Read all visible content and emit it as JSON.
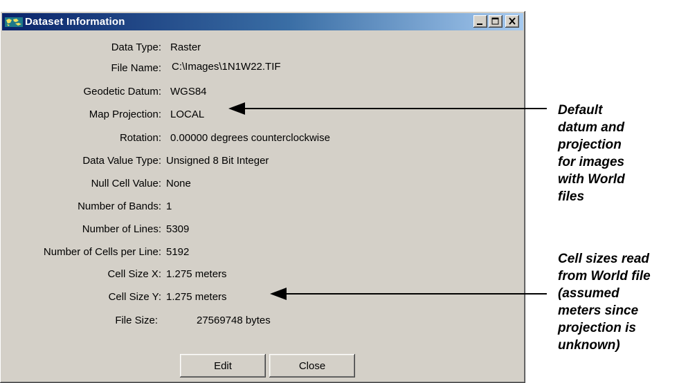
{
  "window": {
    "title": "Dataset Information",
    "controls": {
      "minimize": "minimize",
      "maximize": "maximize",
      "close": "close"
    }
  },
  "fields": [
    {
      "label": "Data Type:",
      "value": "Raster"
    },
    {
      "label": "File Name:",
      "value": "C:\\Images\\1N1W22.TIF"
    },
    {
      "label": "Geodetic Datum:",
      "value": "WGS84"
    },
    {
      "label": "Map Projection:",
      "value": "LOCAL"
    },
    {
      "label": "Rotation:",
      "value": "0.00000 degrees counterclockwise"
    },
    {
      "label": "Data Value Type:",
      "value": "Unsigned 8 Bit Integer"
    },
    {
      "label": "Null Cell Value:",
      "value": "None"
    },
    {
      "label": "Number of Bands:",
      "value": "1"
    },
    {
      "label": "Number of Lines:",
      "value": "5309"
    },
    {
      "label": "Number of Cells per Line:",
      "value": "5192"
    },
    {
      "label": "Cell Size X:",
      "value": "1.275 meters"
    },
    {
      "label": "Cell Size Y:",
      "value": "1.275 meters"
    },
    {
      "label": "File Size:",
      "value": "27569748 bytes"
    }
  ],
  "buttons": {
    "edit": "Edit",
    "close": "Close"
  },
  "annotations": {
    "datum": "Default\ndatum and\nprojection\nfor images\nwith World\nfiles",
    "cell_size": "Cell sizes read\nfrom World file\n(assumed\nmeters since\nprojection is\nunknown)"
  }
}
